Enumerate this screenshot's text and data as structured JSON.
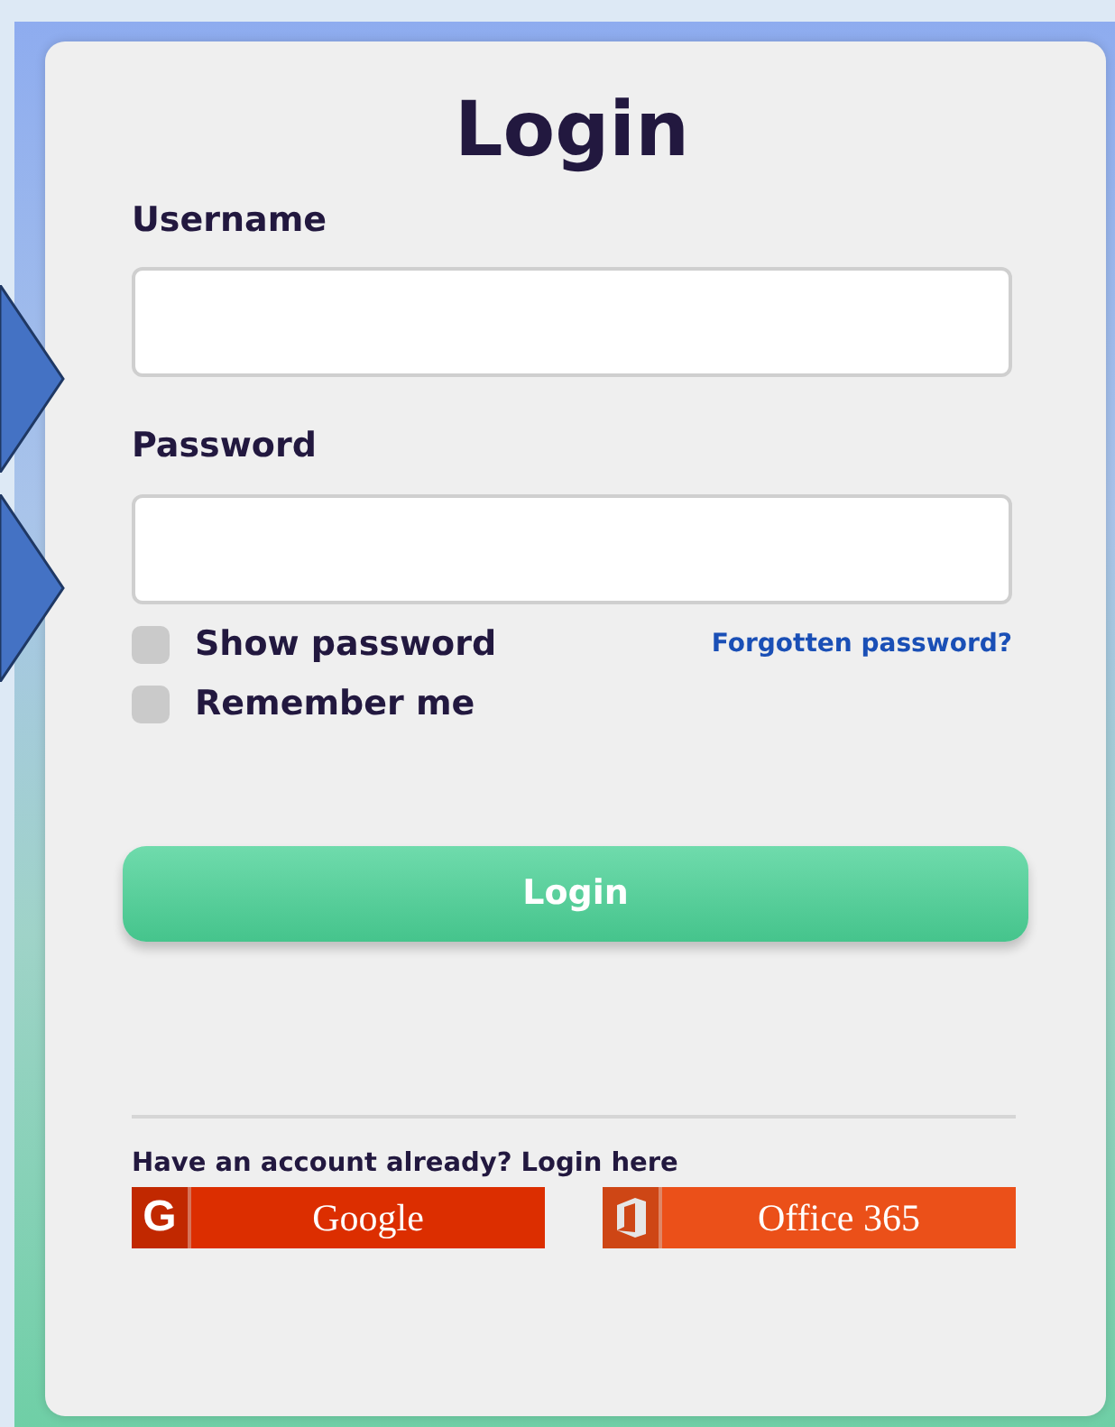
{
  "title": "Login",
  "fields": [
    {
      "label": "Username"
    },
    {
      "label": "Password"
    }
  ],
  "options": [
    {
      "label": "Show password",
      "checked": false
    },
    {
      "label": "Remember me",
      "checked": false
    }
  ],
  "forgot_link": "Forgotten password?",
  "login_button": "Login",
  "social": {
    "prompt": "Have an account already? Login here",
    "providers": [
      {
        "kind": "google",
        "icon_text": "G",
        "label": "Google",
        "color": "#dc2e00"
      },
      {
        "kind": "office",
        "label": "Office 365",
        "color": "#eb5019"
      }
    ]
  }
}
